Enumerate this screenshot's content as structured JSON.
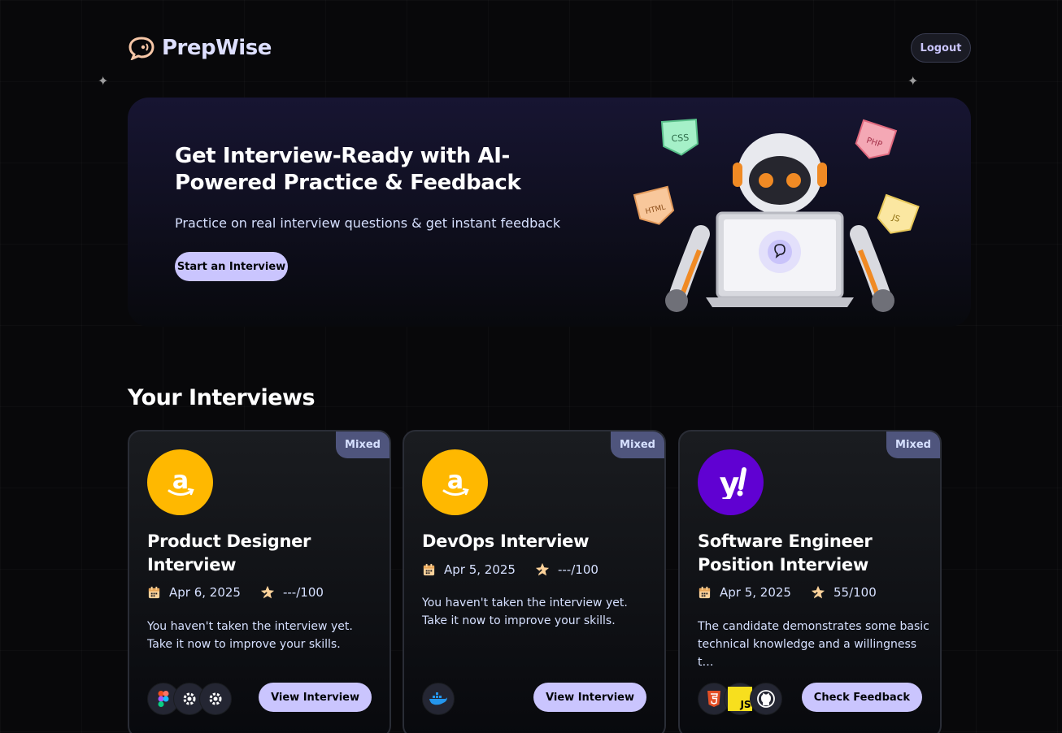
{
  "brand": {
    "name": "PrepWise",
    "logo_icon": "chat-bubble-icon"
  },
  "nav": {
    "logout_label": "Logout"
  },
  "hero": {
    "title": "Get Interview-Ready with AI-Powered Practice & Feedback",
    "subtitle": "Practice on real interview questions & get instant feedback",
    "cta_label": "Start an Interview",
    "tags": [
      "CSS",
      "PHP",
      "HTML",
      "JS"
    ]
  },
  "section": {
    "title": "Your Interviews"
  },
  "interviews": [
    {
      "badge": "Mixed",
      "company_icon": "amazon-logo-icon",
      "title": "Product Designer Interview",
      "date": "Apr 6, 2025",
      "score": "---/100",
      "description": "You haven't taken the interview yet. Take it now to improve your skills.",
      "tech_icons": [
        "figma-icon",
        "gear-icon",
        "gear-icon"
      ],
      "button_label": "View Interview"
    },
    {
      "badge": "Mixed",
      "company_icon": "amazon-logo-icon",
      "title": "DevOps Interview",
      "date": "Apr 5, 2025",
      "score": "---/100",
      "description": "You haven't taken the interview yet. Take it now to improve your skills.",
      "tech_icons": [
        "docker-icon"
      ],
      "button_label": "View Interview"
    },
    {
      "badge": "Mixed",
      "company_icon": "yahoo-logo-icon",
      "title": "Software Engineer Position Interview",
      "date": "Apr 5, 2025",
      "score": "55/100",
      "description": "The candidate demonstrates some basic technical knowledge and a willingness t…",
      "tech_icons": [
        "html5-icon",
        "javascript-icon",
        "github-icon"
      ],
      "button_label": "Check Feedback"
    }
  ],
  "colors": {
    "accent": "#cac5fe",
    "badge_bg": "#4f557d",
    "amazon": "#ffb800",
    "yahoo": "#6001d2"
  }
}
